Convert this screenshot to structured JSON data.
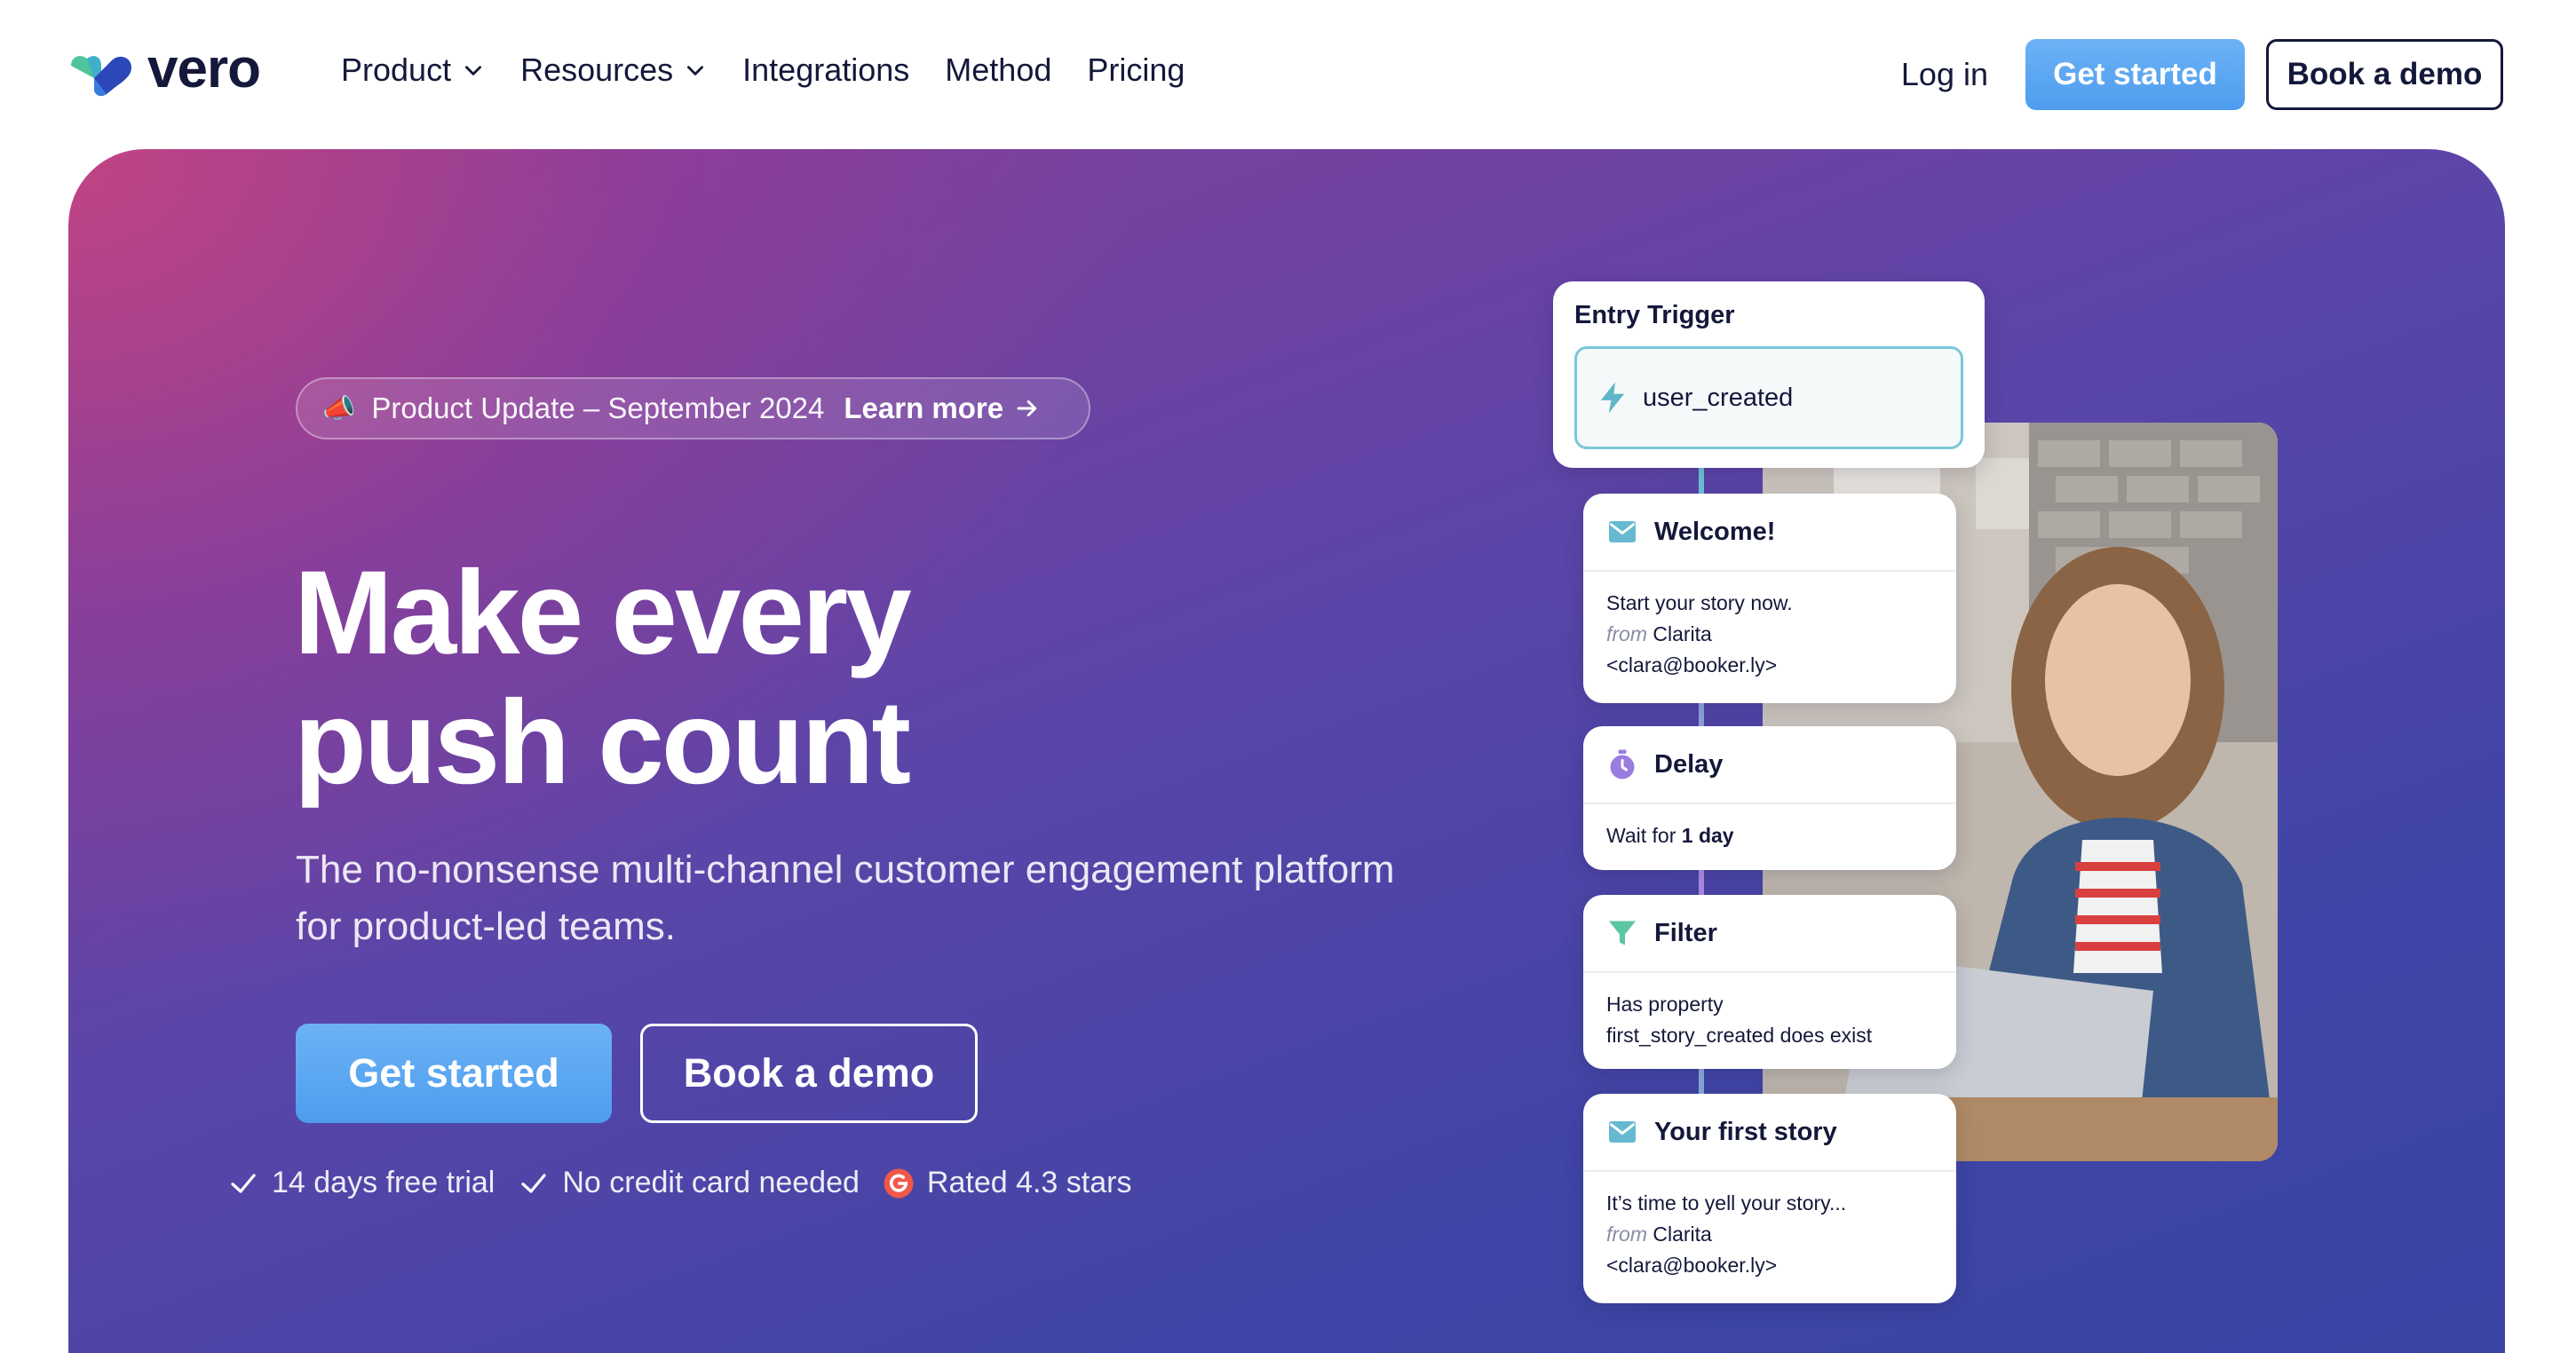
{
  "brand": {
    "name": "vero"
  },
  "nav": {
    "links": [
      {
        "label": "Product",
        "has_dropdown": true
      },
      {
        "label": "Resources",
        "has_dropdown": true
      },
      {
        "label": "Integrations",
        "has_dropdown": false
      },
      {
        "label": "Method",
        "has_dropdown": false
      },
      {
        "label": "Pricing",
        "has_dropdown": false
      }
    ],
    "login": "Log in",
    "get_started": "Get started",
    "book_demo": "Book a demo"
  },
  "announcement": {
    "icon": "megaphone-icon",
    "text": "Product Update – September 2024",
    "link": "Learn more"
  },
  "hero": {
    "headline_line1": "Make every",
    "headline_line2": "push count",
    "subhead": "The no-nonsense multi-channel customer engagement platform for product-led teams.",
    "cta_primary": "Get started",
    "cta_secondary": "Book a demo",
    "bullets": [
      {
        "icon": "check-icon",
        "text": "14 days free trial"
      },
      {
        "icon": "check-icon",
        "text": "No credit card needed"
      },
      {
        "icon": "g2-logo-icon",
        "text": "Rated 4.3 stars"
      }
    ]
  },
  "workflow": {
    "entry": {
      "title": "Entry Trigger",
      "event": "user_created"
    },
    "welcome": {
      "title": "Welcome!",
      "subject": "Start your story now.",
      "from_label": "from",
      "from_name": "Clarita",
      "from_email": "<clara@booker.ly>"
    },
    "delay": {
      "title": "Delay",
      "prefix": "Wait for",
      "duration": "1 day"
    },
    "filter": {
      "title": "Filter",
      "line1": "Has property",
      "line2": "first_story_created does exist"
    },
    "story": {
      "title": "Your first story",
      "subject": "It’s time to yell your story...",
      "from_label": "from",
      "from_name": "Clarita",
      "from_email": "<clara@booker.ly>"
    }
  },
  "colors": {
    "accent_blue": "#5aa6f2",
    "navy": "#14183a",
    "hero_pink": "#c44482",
    "hero_indigo": "#3f45a6",
    "email_icon": "#66b9d1",
    "delay_icon": "#9b7de0",
    "filter_icon": "#5cc6a0"
  }
}
